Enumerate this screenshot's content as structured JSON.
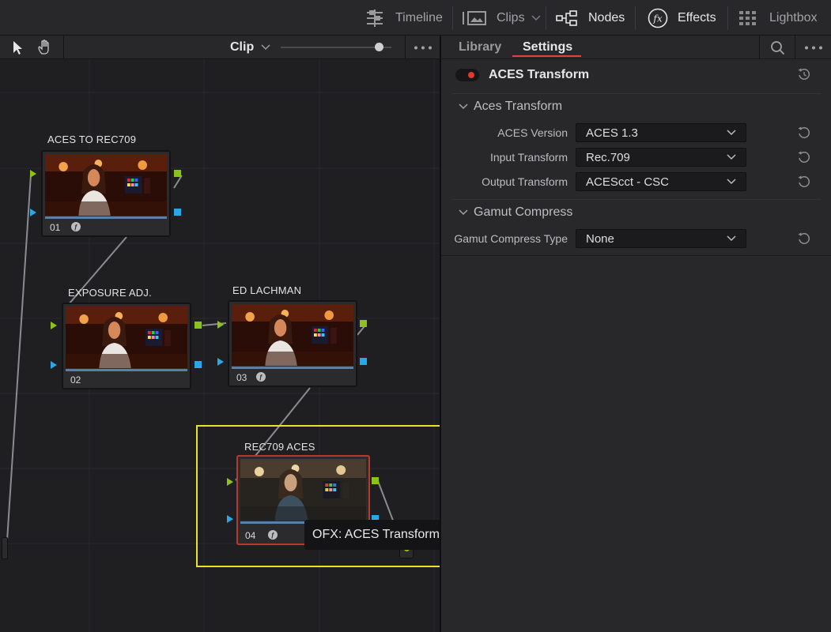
{
  "toolbar": {
    "timeline_label": "Timeline",
    "clips_label": "Clips",
    "nodes_label": "Nodes",
    "effects_label": "Effects",
    "lightbox_label": "Lightbox"
  },
  "node_header": {
    "view_label": "Clip"
  },
  "nodes": [
    {
      "label": "ACES TO REC709",
      "number": "01",
      "has_fx": true
    },
    {
      "label": "EXPOSURE ADJ.",
      "number": "02",
      "has_fx": false
    },
    {
      "label": "ED LACHMAN",
      "number": "03",
      "has_fx": true
    },
    {
      "label": "REC709 ACES",
      "number": "04",
      "has_fx": true
    }
  ],
  "tooltip": "OFX: ACES Transform",
  "panel": {
    "tabs": [
      "Library",
      "Settings"
    ],
    "active_tab": "Settings",
    "effect_title": "ACES Transform",
    "effect_enabled": true,
    "sections": [
      {
        "title": "Aces Transform",
        "fields": [
          {
            "label": "ACES Version",
            "value": "ACES 1.3"
          },
          {
            "label": "Input Transform",
            "value": "Rec.709"
          },
          {
            "label": "Output Transform",
            "value": "ACEScct - CSC"
          }
        ]
      },
      {
        "title": "Gamut Compress",
        "fields": [
          {
            "label": "Gamut Compress Type",
            "value": "None"
          }
        ]
      }
    ]
  },
  "colors": {
    "accent_red": "#e0453a",
    "port_green": "#8cc21c",
    "port_blue": "#2aa7e4",
    "highlight_yellow": "#e8e32a"
  }
}
